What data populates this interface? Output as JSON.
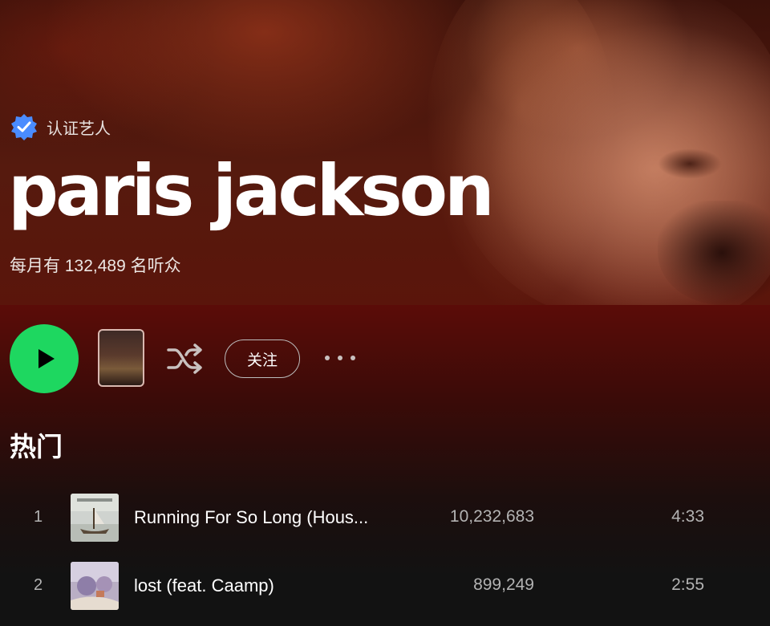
{
  "artist": {
    "verified_label": "认证艺人",
    "name": "paris jackson",
    "monthly_listeners": "每月有 132,489 名听众"
  },
  "controls": {
    "follow_label": "关注",
    "more_label": "• • •",
    "play_color": "#1ed760"
  },
  "popular": {
    "title": "热门",
    "tracks": [
      {
        "number": "1",
        "title": "Running For So Long (Hous...",
        "plays": "10,232,683",
        "duration": "4:33"
      },
      {
        "number": "2",
        "title": "lost (feat. Caamp)",
        "plays": "899,249",
        "duration": "2:55"
      }
    ]
  },
  "icons": {
    "verified": "verified-badge-icon",
    "play": "play-icon",
    "shuffle": "shuffle-icon",
    "more": "more-icon"
  }
}
